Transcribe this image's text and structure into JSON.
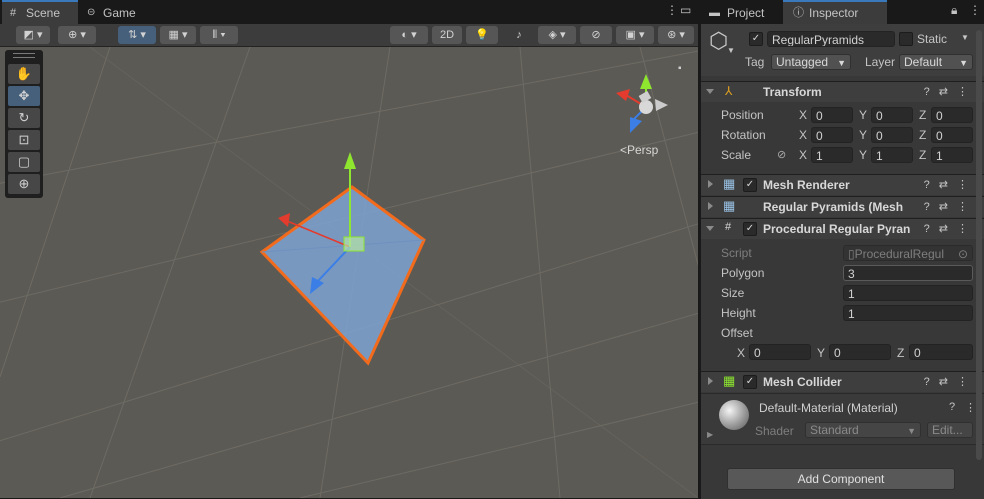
{
  "scene_tabs": [
    {
      "label": "Scene",
      "icon": "grid-icon"
    },
    {
      "label": "Game",
      "icon": "gamepad-icon"
    }
  ],
  "scene_toolbar": {
    "button_2d": "2D",
    "persp_label": "<Persp"
  },
  "inspector_tabs": [
    {
      "label": "Project",
      "icon": "folder-icon"
    },
    {
      "label": "Inspector",
      "icon": "info-icon"
    }
  ],
  "gameobject": {
    "name": "RegularPyramids",
    "static_label": "Static",
    "tag_label": "Tag",
    "tag_value": "Untagged",
    "layer_label": "Layer",
    "layer_value": "Default"
  },
  "transform": {
    "title": "Transform",
    "position_label": "Position",
    "rotation_label": "Rotation",
    "scale_label": "Scale",
    "position": {
      "x": "0",
      "y": "0",
      "z": "0"
    },
    "rotation": {
      "x": "0",
      "y": "0",
      "z": "0"
    },
    "scale": {
      "x": "1",
      "y": "1",
      "z": "1"
    },
    "axis_x": "X",
    "axis_y": "Y",
    "axis_z": "Z"
  },
  "components": {
    "mesh_renderer": "Mesh Renderer",
    "mesh_filter": "Regular Pyramids (Mesh",
    "procedural": "Procedural Regular Pyran"
  },
  "procedural": {
    "script_label": "Script",
    "script_value": "ProceduralRegul",
    "polygon_label": "Polygon",
    "polygon_value": "3",
    "size_label": "Size",
    "size_value": "1",
    "height_label": "Height",
    "height_value": "1",
    "offset_label": "Offset",
    "offset": {
      "x": "0",
      "y": "0",
      "z": "0"
    }
  },
  "mesh_collider": {
    "title": "Mesh Collider"
  },
  "material": {
    "name": "Default-Material (Material)",
    "shader_label": "Shader",
    "shader_value": "Standard",
    "edit_label": "Edit..."
  },
  "add_component_label": "Add Component",
  "colors": {
    "accent": "#3a79bb",
    "selection_outline": "#f26b1d",
    "axis_x": "#e33b2d",
    "axis_y": "#8ee62f",
    "axis_z": "#3a7ee6"
  }
}
